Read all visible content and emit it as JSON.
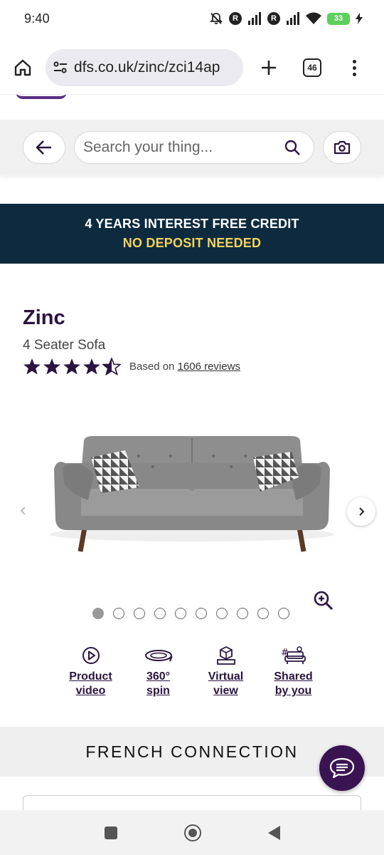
{
  "status_bar": {
    "time": "9:40",
    "battery_level": "33",
    "icons": [
      "mute-icon",
      "r-badge-icon",
      "signal-icon",
      "r-badge-icon",
      "signal-icon",
      "wifi-icon",
      "battery-icon",
      "charging-icon"
    ]
  },
  "browser": {
    "url": "dfs.co.uk/zinc/zci14ap",
    "tab_count": "46",
    "icons": [
      "home-icon",
      "site-settings-icon",
      "plus-icon",
      "tabs-icon",
      "more-vert-icon"
    ]
  },
  "search": {
    "placeholder": "Search your thing...",
    "icons": [
      "back-arrow-icon",
      "search-icon",
      "camera-icon"
    ]
  },
  "promo": {
    "line1": "4 YEARS INTEREST FREE CREDIT",
    "line2": "NO DEPOSIT NEEDED",
    "background": "#0d2a3f",
    "highlight_color": "#f4d35e"
  },
  "product": {
    "name": "Zinc",
    "subtitle": "4 Seater Sofa",
    "rating": 4.5,
    "rating_max": 5,
    "rating_prefix": "Based on ",
    "reviews_link": "1606 reviews",
    "star_color": "#2a1440"
  },
  "gallery": {
    "image_count": 10,
    "active_index": 0,
    "icons": [
      "chevron-left-icon",
      "chevron-right-icon",
      "zoom-in-icon"
    ]
  },
  "features": [
    {
      "line1": "Product",
      "line2": "video",
      "icon": "play-circle-icon"
    },
    {
      "line1": "360°",
      "line2": "spin",
      "icon": "rotate-360-icon"
    },
    {
      "line1": "Virtual",
      "line2": "view",
      "icon": "virtual-view-icon"
    },
    {
      "line1": "Shared",
      "line2": "by you",
      "icon": "shared-sofa-icon"
    }
  ],
  "brand": {
    "name": "FRENCH CONNECTION"
  },
  "chat": {
    "icon": "chat-icon",
    "color": "#3a1352"
  },
  "nav": {
    "icons": [
      "recents-icon",
      "home-circle-icon",
      "back-triangle-icon"
    ]
  }
}
